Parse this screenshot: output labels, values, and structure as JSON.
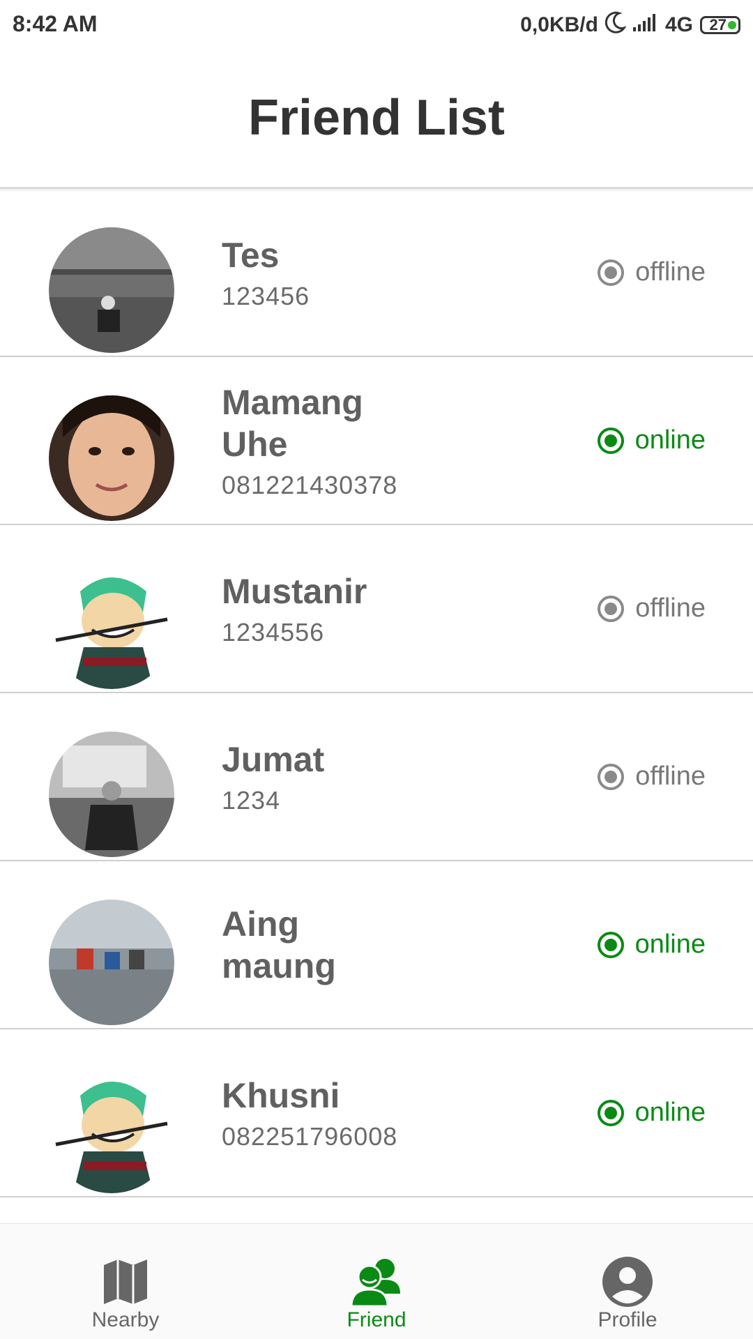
{
  "status_bar": {
    "time": "8:42 AM",
    "network_speed": "0,0KB/d",
    "network_type": "4G",
    "battery_level": "27"
  },
  "header": {
    "title": "Friend List"
  },
  "colors": {
    "online": "#0a8a14",
    "offline": "#8a8a8a",
    "accent": "#0a8a14"
  },
  "friends": [
    {
      "name": "Tes",
      "phone": "123456",
      "status": "offline",
      "avatar": "photo-grayscale-temple"
    },
    {
      "name": "Mamang Uhe",
      "phone": "081221430378",
      "status": "online",
      "avatar": "photo-girl-portrait"
    },
    {
      "name": "Mustanir",
      "phone": "1234556",
      "status": "offline",
      "avatar": "cartoon-swordsman"
    },
    {
      "name": "Jumat",
      "phone": "1234",
      "status": "offline",
      "avatar": "photo-grayscale-street"
    },
    {
      "name": "Aing maung",
      "phone": "",
      "status": "online",
      "avatar": "photo-group-indoor"
    },
    {
      "name": "Khusni",
      "phone": "082251796008",
      "status": "online",
      "avatar": "cartoon-swordsman"
    }
  ],
  "nav": [
    {
      "label": "Nearby",
      "icon": "map-icon",
      "active": false
    },
    {
      "label": "Friend",
      "icon": "friends-icon",
      "active": true
    },
    {
      "label": "Profile",
      "icon": "account-circle-icon",
      "active": false
    }
  ]
}
